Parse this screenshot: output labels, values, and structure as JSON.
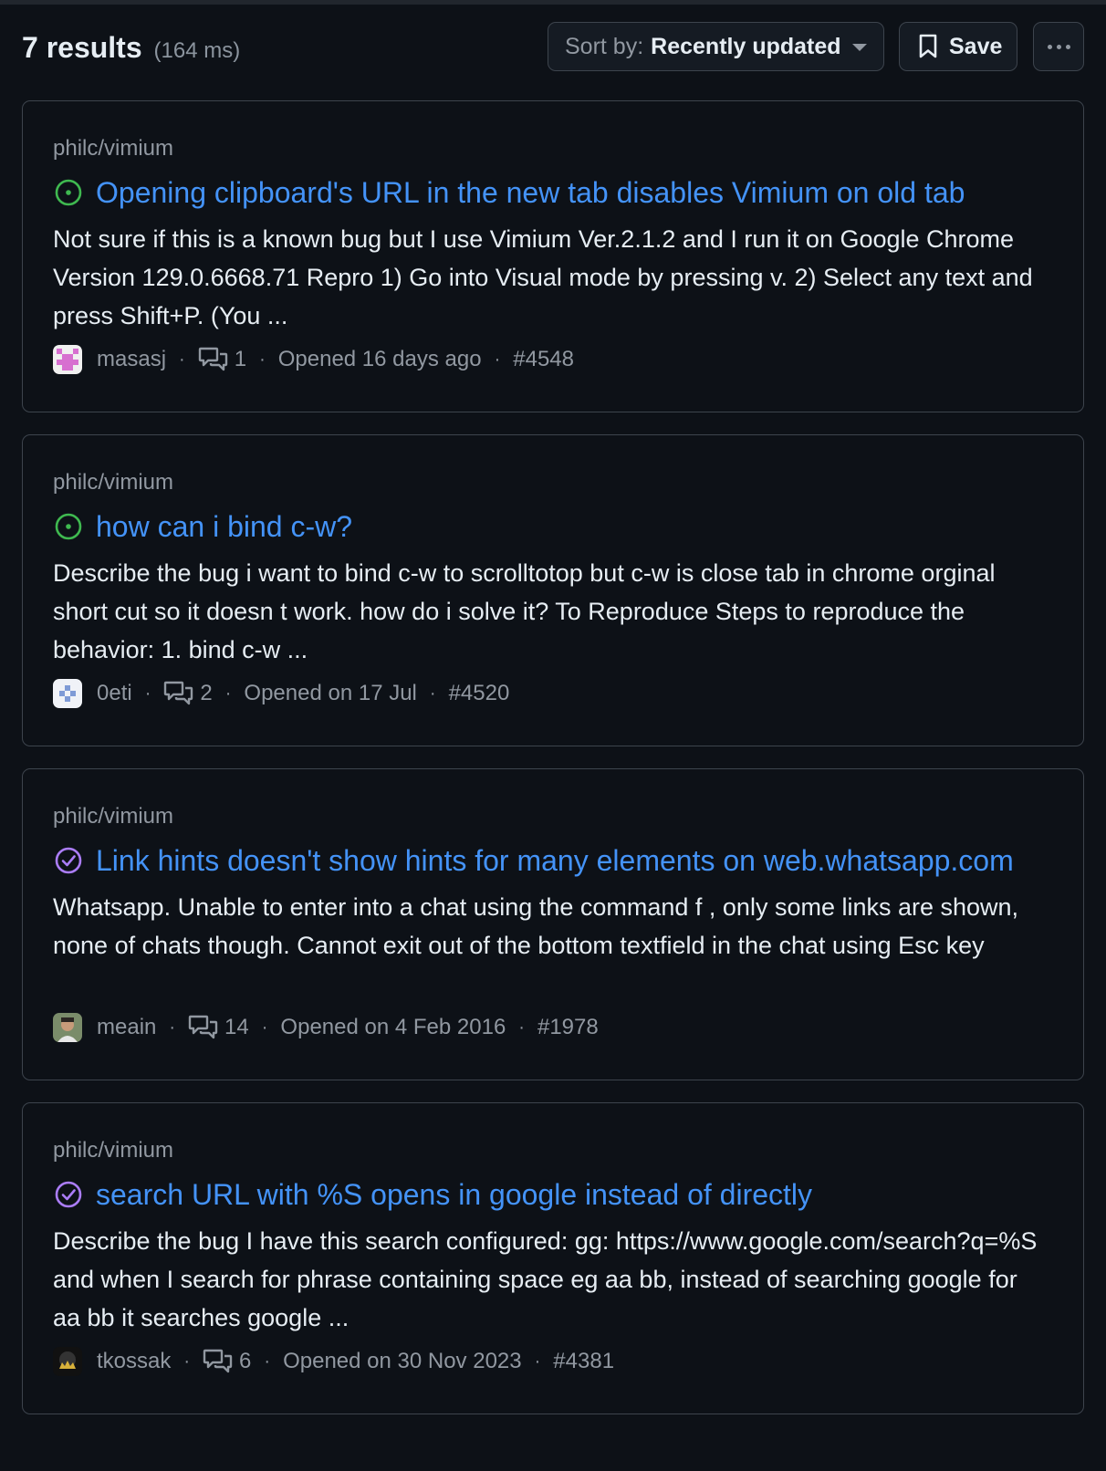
{
  "header": {
    "results_count": "7 results",
    "results_time": "(164 ms)",
    "sort_prefix": "Sort by:",
    "sort_value": "Recently updated",
    "save_label": "Save"
  },
  "colors": {
    "open": "#3fb950",
    "closed": "#ab7df8",
    "link": "#4493f8",
    "muted": "#9198a1"
  },
  "results": [
    {
      "repo": "philc/vimium",
      "state": "open",
      "state_icon": "issue-opened-icon",
      "title": "Opening clipboard's URL in the new tab disables Vimium on old tab",
      "body": "Not sure if this is a known bug but I use Vimium Ver.2.1.2 and I run it on Google Chrome Version 129.0.6668.71 Repro 1) Go into Visual mode by pressing v. 2) Select any text and press Shift+P. (You ...",
      "author": "masasj",
      "comments": "1",
      "opened": "Opened 16 days ago",
      "number": "#4548"
    },
    {
      "repo": "philc/vimium",
      "state": "open",
      "state_icon": "issue-opened-icon",
      "title": "how can i bind c-w?",
      "body": "Describe the bug i want to bind c-w to scrolltotop but c-w is close tab in chrome orginal short cut so it doesn t work. how do i solve it? To Reproduce Steps to reproduce the behavior: 1. bind c-w ...",
      "author": "0eti",
      "comments": "2",
      "opened": "Opened on 17 Jul",
      "number": "#4520"
    },
    {
      "repo": "philc/vimium",
      "state": "closed",
      "state_icon": "issue-closed-icon",
      "title": "Link hints doesn't show hints for many elements on web.whatsapp.com",
      "body": "Whatsapp. Unable to enter into a chat using the command f , only some links are shown, none of chats though. Cannot exit out of the bottom textfield in the chat using Esc key",
      "author": "meain",
      "comments": "14",
      "opened": "Opened on 4 Feb 2016",
      "number": "#1978"
    },
    {
      "repo": "philc/vimium",
      "state": "closed",
      "state_icon": "issue-closed-icon",
      "title": "search URL with %S opens in google instead of directly",
      "body": "Describe the bug I have this search configured: gg: https://www.google.com/search?q=%S and when I search for phrase containing space eg aa bb, instead of searching google for aa bb it searches google ...",
      "author": "tkossak",
      "comments": "6",
      "opened": "Opened on 30 Nov 2023",
      "number": "#4381"
    }
  ]
}
